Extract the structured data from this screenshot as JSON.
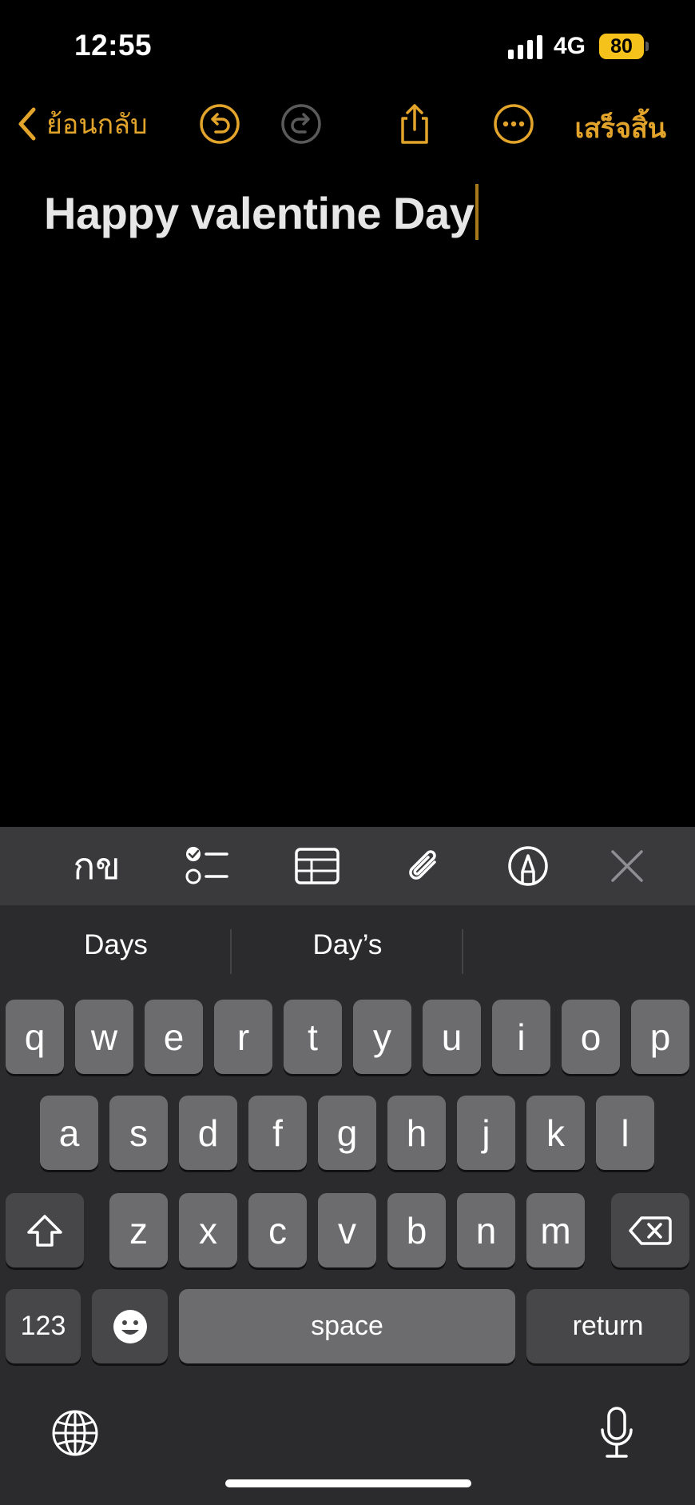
{
  "status_bar": {
    "time": "12:55",
    "network": "4G",
    "battery": "80"
  },
  "nav": {
    "back_label": "ย้อนกลับ",
    "done_label": "เสร็จสิ้น"
  },
  "note": {
    "title": "Happy valentine Day"
  },
  "format_toolbar": {
    "text_style_label": "กข"
  },
  "keyboard": {
    "suggestions": [
      "Days",
      "Day’s",
      ""
    ],
    "row1": [
      "q",
      "w",
      "e",
      "r",
      "t",
      "y",
      "u",
      "i",
      "o",
      "p"
    ],
    "row2": [
      "a",
      "s",
      "d",
      "f",
      "g",
      "h",
      "j",
      "k",
      "l"
    ],
    "row3": [
      "z",
      "x",
      "c",
      "v",
      "b",
      "n",
      "m"
    ],
    "numbers_label": "123",
    "space_label": "space",
    "return_label": "return"
  },
  "colors": {
    "accent": "#e2a42a",
    "background": "#000000",
    "keyboard_bg": "#2b2b2d",
    "key": "#6c6c6e",
    "key_dark": "#474749"
  }
}
